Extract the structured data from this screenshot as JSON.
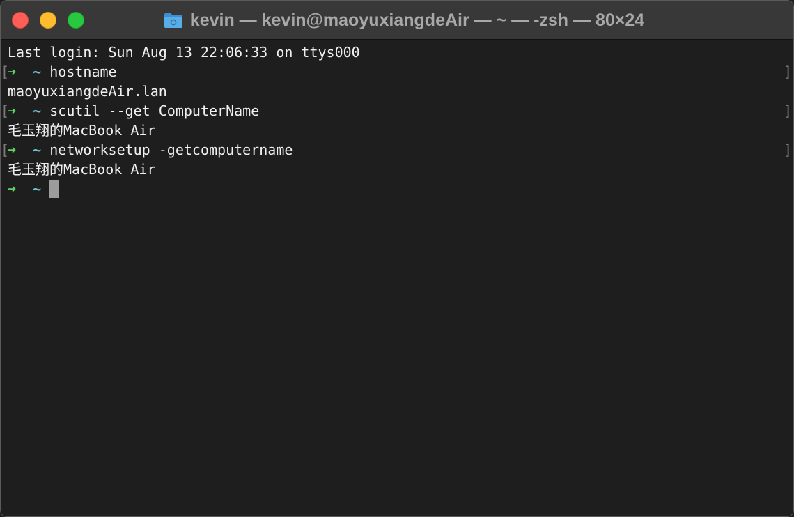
{
  "window": {
    "title": "kevin — kevin@maoyuxiangdeAir — ~ — -zsh — 80×24"
  },
  "terminal": {
    "last_login": "Last login: Sun Aug 13 22:06:33 on ttys000",
    "prompt_arrow": "➜",
    "prompt_dir": "~",
    "commands": [
      {
        "command": "hostname",
        "output": "maoyuxiangdeAir.lan"
      },
      {
        "command": "scutil --get ComputerName",
        "output": "毛玉翔的MacBook Air"
      },
      {
        "command": "networksetup -getcomputername",
        "output": "毛玉翔的MacBook Air"
      }
    ],
    "mark_left": "[",
    "mark_right": "]"
  },
  "colors": {
    "arrow": "#5fd35f",
    "tilde": "#6ec3d4",
    "cursor": "#9c9c9c"
  },
  "icons": {
    "title_icon": "folder-icon"
  }
}
